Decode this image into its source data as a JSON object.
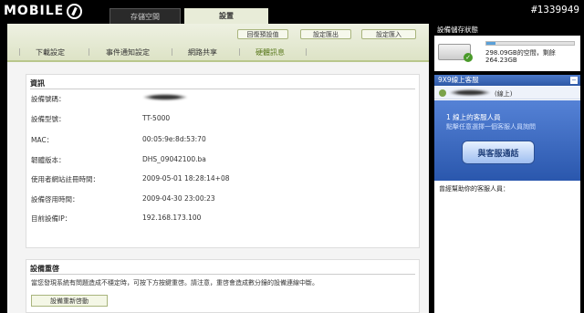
{
  "header": {
    "logo_text": "MOBILE",
    "watermark": "#1339949",
    "tabs": [
      {
        "label": "存儲空間"
      },
      {
        "label": "設置"
      }
    ]
  },
  "toolbar": {
    "reset_default": "回復預設值",
    "export_settings": "設定匯出",
    "import_settings": "設定匯入"
  },
  "subnav": [
    {
      "label": "下載設定"
    },
    {
      "label": "事件通知設定"
    },
    {
      "label": "網路共享"
    },
    {
      "label": "硬體訊息"
    }
  ],
  "info": {
    "title": "資訊",
    "rows": [
      {
        "label": "設備號碼：",
        "value": ""
      },
      {
        "label": "設備型號：",
        "value": "TT-5000"
      },
      {
        "label": "MAC：",
        "value": "00:05:9e:8d:53:70"
      },
      {
        "label": "韌體版本：",
        "value": "DHS_09042100.ba"
      },
      {
        "label": "使用者網站註冊時間：",
        "value": "2009-05-01 18:28:14+08"
      },
      {
        "label": "設備啓用時間：",
        "value": "2009-04-30 23:00:23"
      },
      {
        "label": "目前設備IP：",
        "value": "192.168.173.100"
      }
    ]
  },
  "reset": {
    "title": "設備重啓",
    "description": "當您發現系統有問題造成不穩定時，可按下方按鍵重啓。請注意，重啓會造成數分鐘的設備連線中斷。",
    "button": "設備重新啓動"
  },
  "storage": {
    "title": "設備儲存狀態",
    "usage_fraction": 0.1,
    "free_text": "298.09GB的空間，剩餘",
    "used_text": "264.23GB"
  },
  "support": {
    "title": "9X9線上客服",
    "agent_status": "(線上)",
    "online_count": "1 線上的客服人員",
    "hint": "點擊任意選擇一個客服人員詢問",
    "chat_button": "與客服通話",
    "past_label": "曾經幫助你的客服人員："
  }
}
